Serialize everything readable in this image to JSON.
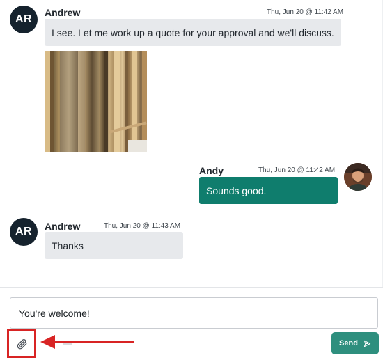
{
  "messages": [
    {
      "sender": "Andrew",
      "initials": "AR",
      "time": "Thu, Jun 20 @ 11:42 AM",
      "text": "I see. Let me work up a quote for your approval and we'll discuss.",
      "direction": "incoming",
      "has_photo": true
    },
    {
      "sender": "Andy",
      "time": "Thu, Jun 20 @ 11:42 AM",
      "text": "Sounds good.",
      "direction": "outgoing"
    },
    {
      "sender": "Andrew",
      "initials": "AR",
      "time": "Thu, Jun 20 @ 11:43 AM",
      "text": "Thanks",
      "direction": "incoming"
    }
  ],
  "composer": {
    "value": "You're welcome!",
    "send_label": "Send",
    "send_icon": "send-icon",
    "attach_icon": "paperclip-icon"
  },
  "annotation": {
    "highlight_color": "#d82424"
  },
  "colors": {
    "avatar_bg": "#15222d",
    "incoming_bubble": "#e7e9ec",
    "outgoing_bubble": "#0f7d6d",
    "send_button": "#2e8f7e"
  }
}
